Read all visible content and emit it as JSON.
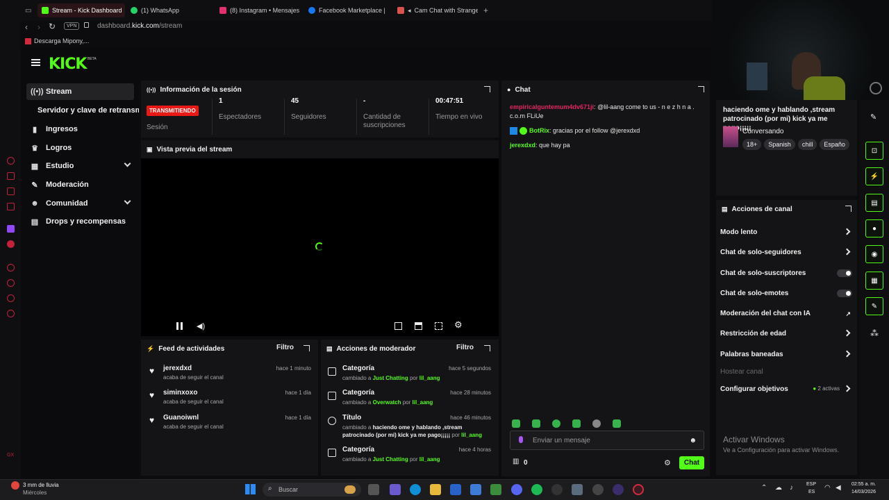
{
  "browser": {
    "tabs": [
      {
        "title": "Stream - Kick Dashboard",
        "color": "#53fc18",
        "active": true
      },
      {
        "title": "(1) WhatsApp",
        "color": "#25d366"
      },
      {
        "title": "(8) Instagram • Mensajes",
        "color": "#e1306c"
      },
      {
        "title": "Facebook Marketplace | F",
        "color": "#1877f2"
      },
      {
        "title": "Cam Chat with Strange",
        "color": "#d9534f"
      }
    ],
    "address_prefix": "dashboard.",
    "address_domain": "kick.com",
    "address_path": "/stream",
    "vpn_label": "VPN",
    "bookmark": "Descarga Mipony,..."
  },
  "kick": {
    "logo": "KICK",
    "logo_badge": "BETA"
  },
  "nav": {
    "items": [
      {
        "label": "Stream",
        "icon": "stream-icon"
      },
      {
        "label": "Servidor y clave de retransmisión"
      },
      {
        "label": "Ingresos",
        "icon": "chart-icon"
      },
      {
        "label": "Logros",
        "icon": "trophy-icon"
      },
      {
        "label": "Estudio",
        "icon": "grid-icon"
      },
      {
        "label": "Moderación",
        "icon": "wrench-icon"
      },
      {
        "label": "Comunidad",
        "icon": "people-icon"
      },
      {
        "label": "Drops y recompensas",
        "icon": "gift-icon"
      }
    ]
  },
  "session": {
    "title": "Información de la sesión",
    "live_badge": "TRANSMITIENDO",
    "session_label": "Sesión",
    "viewers_value": "1",
    "viewers_label": "Espectadores",
    "followers_value": "45",
    "followers_label": "Seguidores",
    "subs_value": "-",
    "subs_label": "Cantidad de suscripciones",
    "uptime_value": "00:47:51",
    "uptime_label": "Tiempo en vivo"
  },
  "preview": {
    "title": "Vista previa del stream"
  },
  "activity": {
    "title": "Feed de actividades",
    "filter": "Filtro",
    "rows": [
      {
        "name": "jerexdxd",
        "sub": "acaba de seguir el canal",
        "time": "hace 1 minuto"
      },
      {
        "name": "siminxoxo",
        "sub": "acaba de seguir el canal",
        "time": "hace 1 día"
      },
      {
        "name": "Guanoiwnl",
        "sub": "acaba de seguir el canal",
        "time": "hace 1 día"
      }
    ]
  },
  "modactions": {
    "title": "Acciones de moderador",
    "filter": "Filtro",
    "rows": [
      {
        "name": "Categoría",
        "pre": "cambiado a",
        "value": "Just Chatting",
        "by": "por",
        "user": "lil_aang",
        "time": "hace 5 segundos"
      },
      {
        "name": "Categoría",
        "pre": "cambiado a",
        "value": "Overwatch",
        "by": "por",
        "user": "lil_aang",
        "time": "hace 28 minutos"
      },
      {
        "name": "Título",
        "pre": "cambiado a",
        "value": "haciendo ome y hablando ,stream patrocinado (por mi) kick ya me pago¡¡¡¡¡",
        "by": "por",
        "user": "lil_aang",
        "time": "hace 46 minutos"
      },
      {
        "name": "Categoría",
        "pre": "cambiado a",
        "value": "Just Chatting",
        "by": "por",
        "user": "lil_aang",
        "time": "hace 4 horas"
      }
    ]
  },
  "chat": {
    "title": "Chat",
    "messages": [
      {
        "user": "empiricalguntemum4dv671ji",
        "user_color": "#e0245e",
        "text": "@lil-aang come to us - n e z h n a . c.o.m FLiUe"
      },
      {
        "user": "BotRix",
        "user_color": "#53fc18",
        "text": "gracias por el follow @jerexdxd"
      },
      {
        "user": "jerexdxd",
        "user_color": "#53fc18",
        "text": "que hay pa"
      }
    ],
    "input_placeholder": "Enviar un mensaje",
    "points": "0",
    "send_label": "Chat"
  },
  "stream_info": {
    "title": "haciendo ome y hablando ,stream patrocinado (por mi) kick ya me pago¡¡¡¡¡",
    "category": "Conversando",
    "tags": [
      "18+",
      "Spanish",
      "chill",
      "Españo"
    ]
  },
  "channel_actions": {
    "title": "Acciones de canal",
    "items": [
      {
        "label": "Modo lento",
        "control": "arrow"
      },
      {
        "label": "Chat de solo-seguidores",
        "control": "arrow"
      },
      {
        "label": "Chat de solo-suscriptores",
        "control": "toggle"
      },
      {
        "label": "Chat de solo-emotes",
        "control": "toggle"
      },
      {
        "label": "Moderación del chat con IA",
        "control": "external"
      },
      {
        "label": "Restricción de edad",
        "control": "arrow"
      },
      {
        "label": "Palabras baneadas",
        "control": "arrow"
      },
      {
        "label": "Hostear canal",
        "control": "none"
      },
      {
        "label": "Configurar objetivos",
        "control": "arrow"
      }
    ],
    "goals_status": "2 activas"
  },
  "windows": {
    "activate_title": "Activar Windows",
    "activate_sub": "Ve a Configuración para activar Windows.",
    "weather": "3 mm de lluvia",
    "weather_day": "Miércoles",
    "search": "Buscar",
    "lang1": "ESP",
    "lang2": "ES",
    "time": "02:55 a. m.",
    "date": "14/03/2026"
  }
}
